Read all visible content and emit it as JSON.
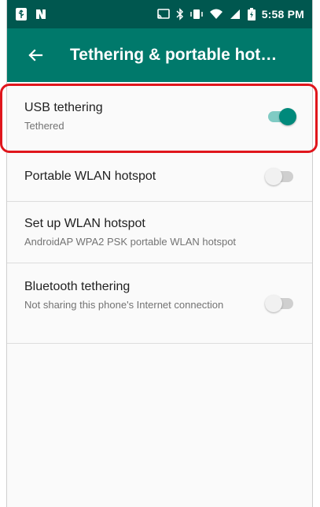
{
  "status_bar": {
    "time": "5:58 PM",
    "left_icons": [
      "usb-icon",
      "nfc-icon"
    ],
    "right_icons": [
      "cast-icon",
      "bluetooth-icon",
      "vibrate-icon",
      "wifi-icon",
      "cell-signal-icon",
      "battery-icon"
    ]
  },
  "app_bar": {
    "title": "Tethering & portable hot…",
    "back_icon": "arrow-back-icon"
  },
  "settings": [
    {
      "key": "usb",
      "title": "USB tethering",
      "subtitle": "Tethered",
      "toggle": true
    },
    {
      "key": "hotspot",
      "title": "Portable WLAN hotspot",
      "subtitle": "",
      "toggle": false
    },
    {
      "key": "setup",
      "title": "Set up WLAN hotspot",
      "subtitle": "AndroidAP WPA2 PSK portable WLAN hotspot"
    },
    {
      "key": "bluetooth",
      "title": "Bluetooth tethering",
      "subtitle": "Not sharing this phone's Internet connection",
      "toggle": false
    }
  ],
  "colors": {
    "status_bar": "#00574f",
    "app_bar": "#00796b",
    "accent": "#00897b",
    "highlight": "#e0161c"
  }
}
